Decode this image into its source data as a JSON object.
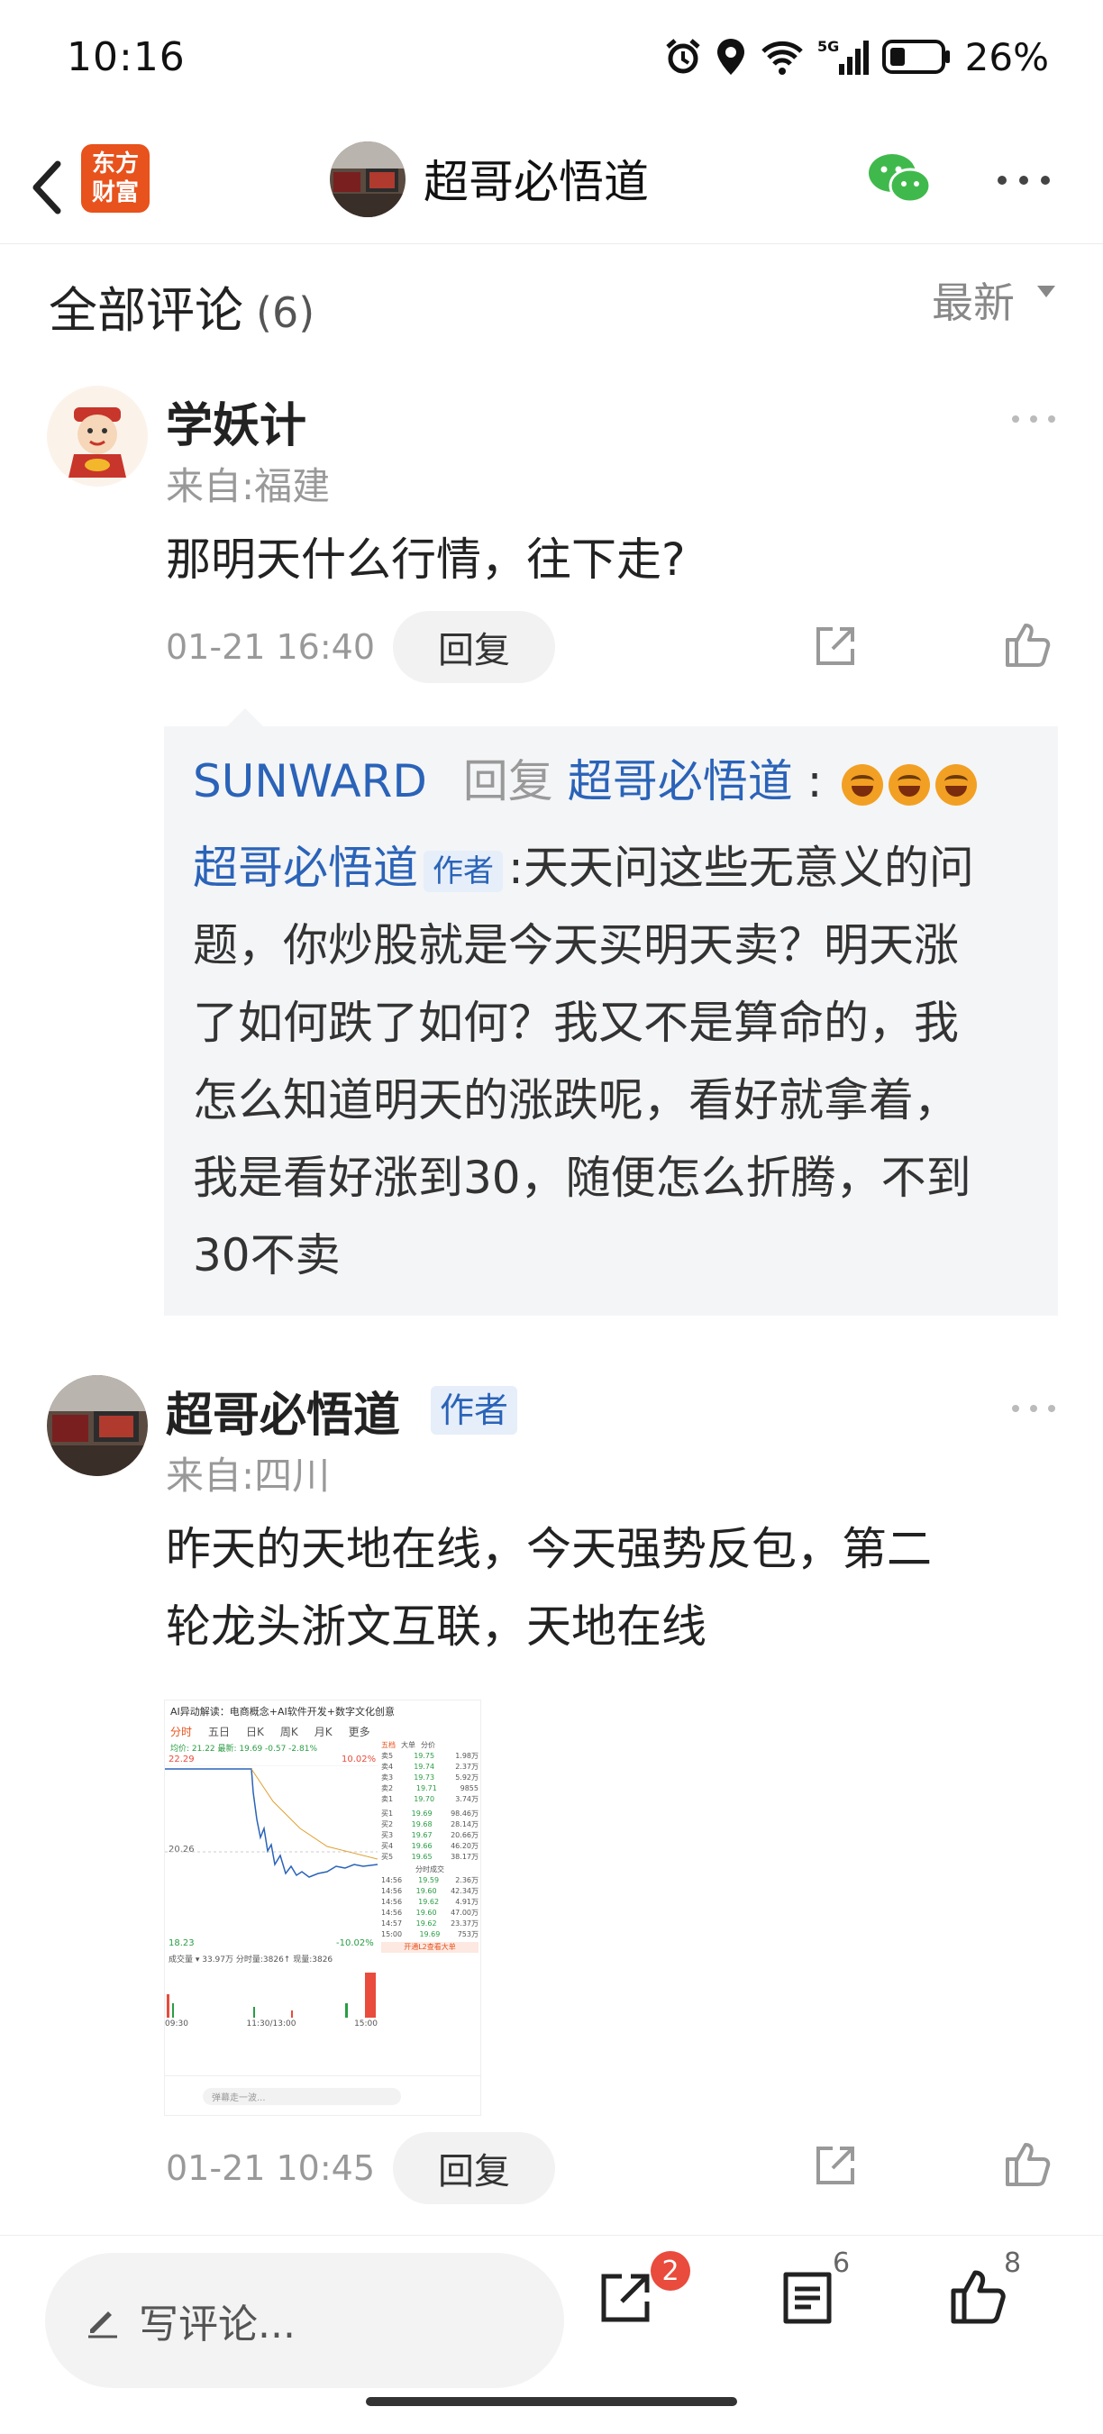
{
  "status_bar": {
    "time": "10:16",
    "battery": "26%",
    "network": "5G"
  },
  "nav": {
    "logo_line1": "东方",
    "logo_line2": "财富",
    "title": "超哥必悟道"
  },
  "comments_header": {
    "title": "全部评论",
    "count": "(6)",
    "sort": "最新"
  },
  "comment1": {
    "username": "学妖计",
    "from": "来自:福建",
    "text": "那明天什么行情，往下走?",
    "date": "01-21 16:40",
    "reply_label": "回复",
    "quote": {
      "reply_user": "SUNWARD",
      "reply_word": "回复",
      "reply_target": "超哥必悟道",
      "colon": ":",
      "author": "超哥必悟道",
      "author_tag": "作者",
      "author_colon": ":",
      "lines": [
        "天天问这些无意义的问",
        "题，你炒股就是今天买明天卖？明天涨",
        "了如何跌了如何？我又不是算命的，我",
        "怎么知道明天的涨跌呢，看好就拿着，",
        "我是看好涨到30，随便怎么折腾，不到",
        "30不卖"
      ]
    }
  },
  "comment2": {
    "username": "超哥必悟道",
    "author_tag": "作者",
    "from": "来自:四川",
    "text_line1": "昨天的天地在线，今天强势反包，第二",
    "text_line2": "轮龙头浙文互联，天地在线",
    "date": "01-21 10:45",
    "reply_label": "回复",
    "image": {
      "headline": "AI异动解读：电商概念+AI软件开发+数字文化创意",
      "tabs": [
        "分时",
        "五日",
        "日K",
        "周K",
        "月K",
        "更多"
      ],
      "price_line": "均价: 21.22 最新: 19.69 -0.57 -2.81%",
      "high": "22.29",
      "mid": "20.26",
      "low": "18.23",
      "up_pct": "10.02%",
      "down_pct": "-10.02%",
      "side_tabs": [
        "五档",
        "大单",
        "分价"
      ],
      "sell": [
        [
          "卖5",
          "19.75",
          "1.98万"
        ],
        [
          "卖4",
          "19.74",
          "2.37万"
        ],
        [
          "卖3",
          "19.73",
          "5.92万"
        ],
        [
          "卖2",
          "19.71",
          "9855"
        ],
        [
          "卖1",
          "19.70",
          "3.74万"
        ]
      ],
      "buy": [
        [
          "买1",
          "19.69",
          "98.46万"
        ],
        [
          "买2",
          "19.68",
          "28.14万"
        ],
        [
          "买3",
          "19.67",
          "20.66万"
        ],
        [
          "买4",
          "19.66",
          "46.20万"
        ],
        [
          "买5",
          "19.65",
          "38.17万"
        ]
      ],
      "trades_title": "分时成交",
      "trades": [
        [
          "14:56",
          "19.59",
          "2.36万"
        ],
        [
          "14:56",
          "19.60",
          "42.34万"
        ],
        [
          "14:56",
          "19.62",
          "4.91万"
        ],
        [
          "14:56",
          "19.60",
          "47.00万"
        ],
        [
          "14:57",
          "19.62",
          "23.37万"
        ],
        [
          "15:00",
          "19.69",
          "753万"
        ]
      ],
      "volume_line": "成交量 ▾ 33.97万  分时量:3826↑  现量:3826",
      "times": [
        "09:30",
        "11:30/13:00",
        "15:00"
      ],
      "l2": "开通L2查看大单",
      "danmu": "弹幕走一波..."
    }
  },
  "bottom": {
    "write_placeholder": "写评论...",
    "share_badge": "2",
    "comments_count": "6",
    "likes_count": "8"
  },
  "colors": {
    "accent_blue": "#2a63b8",
    "logo_orange": "#e8521c",
    "badge_red": "#e94b3c"
  }
}
